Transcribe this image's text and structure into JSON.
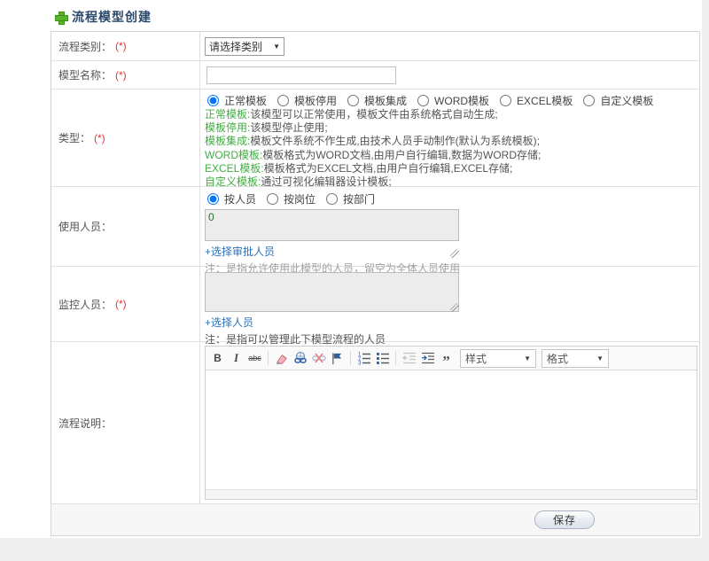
{
  "header": {
    "title": "流程模型创建"
  },
  "rows": {
    "category": {
      "label": "流程类别：",
      "required": "(*)",
      "select_value": "请选择类别"
    },
    "name": {
      "label": "模型名称：",
      "required": "(*)",
      "input_value": ""
    },
    "type": {
      "label": "类型：",
      "required": "(*)",
      "selected": "正常模板",
      "options": [
        "正常模板",
        "模板停用",
        "模板集成",
        "WORD模板",
        "EXCEL模板",
        "自定义模板"
      ],
      "descriptions": [
        {
          "term": "正常模板:",
          "text": "该模型可以正常使用，模板文件由系统格式自动生成;"
        },
        {
          "term": "模板停用:",
          "text": "该模型停止使用;"
        },
        {
          "term": "模板集成:",
          "text": "模板文件系统不作生成,由技术人员手动制作(默认为系统模板);"
        },
        {
          "term": "WORD模板:",
          "text": "模板格式为WORD文档,由用户自行编辑,数据为WORD存储;"
        },
        {
          "term": "EXCEL模板:",
          "text": "模板格式为EXCEL文档,由用户自行编辑,EXCEL存储;"
        },
        {
          "term": "自定义模板:",
          "text": "通过可视化编辑器设计模板;"
        }
      ]
    },
    "users": {
      "label": "使用人员：",
      "selected": "按人员",
      "options": [
        "按人员",
        "按岗位",
        "按部门"
      ],
      "textarea_value": "0",
      "link": "+选择审批人员",
      "note": "注：是指允许使用此模型的人员，留空为全体人员使用"
    },
    "monitors": {
      "label": "监控人员：",
      "required": "(*)",
      "textarea_value": "",
      "link": "+选择人员",
      "note": "注：是指可以管理此下模型流程的人员"
    },
    "description": {
      "label": "流程说明：",
      "editor": {
        "bold": "B",
        "italic": "I",
        "strike": "abc",
        "quote": "”",
        "styles_combo": "样式",
        "format_combo": "格式"
      }
    }
  },
  "footer": {
    "save_label": "保存"
  },
  "icons": {
    "select_arrow": "▼",
    "combo_arrow": "▼",
    "colors": {
      "green": "#3fae3f",
      "required_red": "#e53333",
      "link_blue": "#2d71b8",
      "title_navy": "#2b4a6b"
    }
  }
}
